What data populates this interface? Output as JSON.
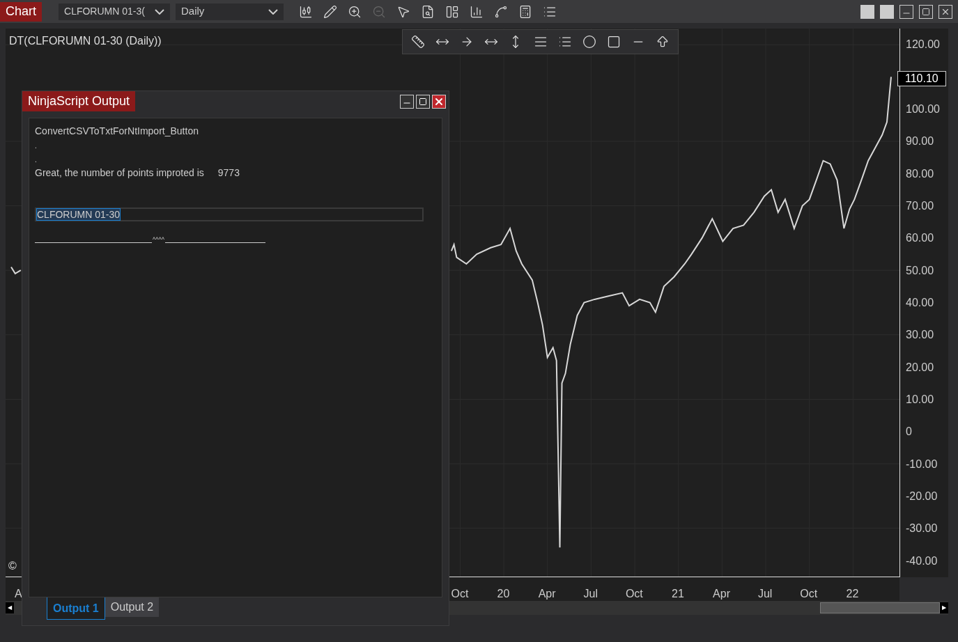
{
  "toolbar": {
    "title": "Chart",
    "instrument": "CLFORUMN 01-3(",
    "interval": "Daily"
  },
  "chart": {
    "title": "DT(CLFORUMN 01-30 (Daily))",
    "copyright": "©",
    "bottom_left": "A",
    "last_price": "110.10",
    "chart_data": {
      "type": "line",
      "grid": true,
      "ylim": [
        -45,
        125
      ],
      "xlim": [
        17.147,
        22.266
      ],
      "x": [
        17.179,
        17.202,
        17.234,
        19.7,
        19.715,
        19.73,
        19.786,
        19.845,
        19.925,
        19.984,
        20.036,
        20.071,
        20.103,
        20.163,
        20.194,
        20.222,
        20.25,
        20.282,
        20.302,
        20.321,
        20.333,
        20.353,
        20.381,
        20.421,
        20.46,
        20.52,
        20.599,
        20.679,
        20.718,
        20.778,
        20.837,
        20.869,
        20.917,
        20.976,
        21.036,
        21.075,
        21.135,
        21.194,
        21.254,
        21.313,
        21.373,
        21.433,
        21.492,
        21.532,
        21.571,
        21.611,
        21.663,
        21.71,
        21.75,
        21.79,
        21.829,
        21.869,
        21.909,
        21.948,
        21.98,
        22.008,
        22.048,
        22.087,
        22.127,
        22.167,
        22.194,
        22.218
      ],
      "series": [
        {
          "color": "#d8d8d8",
          "values": [
            51,
            49,
            50,
            56,
            58,
            54,
            52,
            55,
            57,
            58,
            63,
            56,
            52,
            47,
            40,
            33,
            23,
            26,
            22,
            -36,
            15,
            18,
            27,
            36,
            40,
            41,
            42,
            43,
            39,
            41,
            40,
            37,
            45,
            48,
            52,
            55,
            60,
            66,
            59,
            63,
            64,
            68,
            73,
            75,
            68,
            72,
            63,
            70,
            72,
            78,
            84,
            83,
            78,
            63,
            69,
            72,
            78,
            84,
            88,
            92,
            96,
            110
          ]
        }
      ],
      "yticks": [
        {
          "value": 120,
          "label": "120.00"
        },
        {
          "value": 100,
          "label": "100.00"
        },
        {
          "value": 90,
          "label": "90.00"
        },
        {
          "value": 80,
          "label": "80.00"
        },
        {
          "value": 70,
          "label": "70.00"
        },
        {
          "value": 60,
          "label": "60.00"
        },
        {
          "value": 50,
          "label": "50.00"
        },
        {
          "value": 40,
          "label": "40.00"
        },
        {
          "value": 30,
          "label": "30.00"
        },
        {
          "value": 20,
          "label": "20.00"
        },
        {
          "value": 10,
          "label": "10.00"
        },
        {
          "value": 0,
          "label": "0"
        },
        {
          "value": -10,
          "label": "-10.00"
        },
        {
          "value": -20,
          "label": "-20.00"
        },
        {
          "value": -30,
          "label": "-30.00"
        },
        {
          "value": -40,
          "label": "-40.00"
        }
      ],
      "xticks": [
        {
          "value": 19.75,
          "label": "Oct"
        },
        {
          "value": 20,
          "label": "20"
        },
        {
          "value": 20.25,
          "label": "Apr"
        },
        {
          "value": 20.5,
          "label": "Jul"
        },
        {
          "value": 20.75,
          "label": "Oct"
        },
        {
          "value": 21,
          "label": "21"
        },
        {
          "value": 21.25,
          "label": "Apr"
        },
        {
          "value": 21.5,
          "label": "Jul"
        },
        {
          "value": 21.75,
          "label": "Oct"
        },
        {
          "value": 22,
          "label": "22"
        }
      ]
    }
  },
  "scrollbar": {
    "left": "◀",
    "right": "▶"
  },
  "output_window": {
    "title": "NinjaScript Output",
    "lines": [
      {
        "kind": "text",
        "text": "ConvertCSVToTxtForNtImport_Button"
      },
      {
        "kind": "text",
        "text": "."
      },
      {
        "kind": "text",
        "text": "."
      },
      {
        "kind": "pair",
        "text": "Great, the number of points improted is",
        "value": "9773"
      },
      {
        "kind": "field",
        "text": "CLFORUMN 01-30"
      },
      {
        "kind": "separator",
        "text": "^^^^"
      }
    ],
    "tabs": [
      {
        "label": "Output 1",
        "selected": true
      },
      {
        "label": "Output 2",
        "selected": false
      }
    ]
  }
}
